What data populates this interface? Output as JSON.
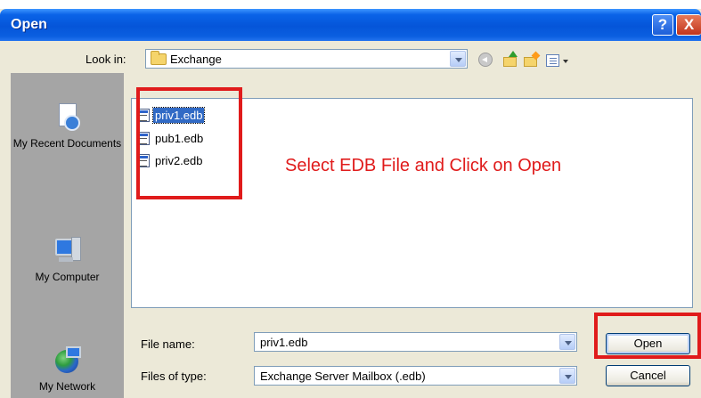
{
  "window": {
    "title": "Open"
  },
  "titlebar": {
    "help_label": "?",
    "close_label": "X"
  },
  "lookin": {
    "label": "Look in:",
    "value": "Exchange"
  },
  "places": [
    {
      "label": "My Recent Documents",
      "icon": "recent-documents-icon"
    },
    {
      "label": "My Computer",
      "icon": "my-computer-icon"
    },
    {
      "label": "My Network",
      "icon": "network-icon"
    }
  ],
  "files": [
    {
      "name": "priv1.edb",
      "selected": true
    },
    {
      "name": "pub1.edb",
      "selected": false
    },
    {
      "name": "priv2.edb",
      "selected": false
    }
  ],
  "annotation": {
    "text": "Select EDB File and Click on Open",
    "color": "#e01b1b"
  },
  "filename": {
    "label": "File name:",
    "value": "priv1.edb"
  },
  "filetype": {
    "label": "Files of type:",
    "value": "Exchange Server Mailbox (.edb)"
  },
  "buttons": {
    "open_label": "Open",
    "cancel_label": "Cancel"
  },
  "colors": {
    "titlebar": "#0555d9",
    "selection": "#316ac5",
    "highlight": "#e01b1b"
  }
}
